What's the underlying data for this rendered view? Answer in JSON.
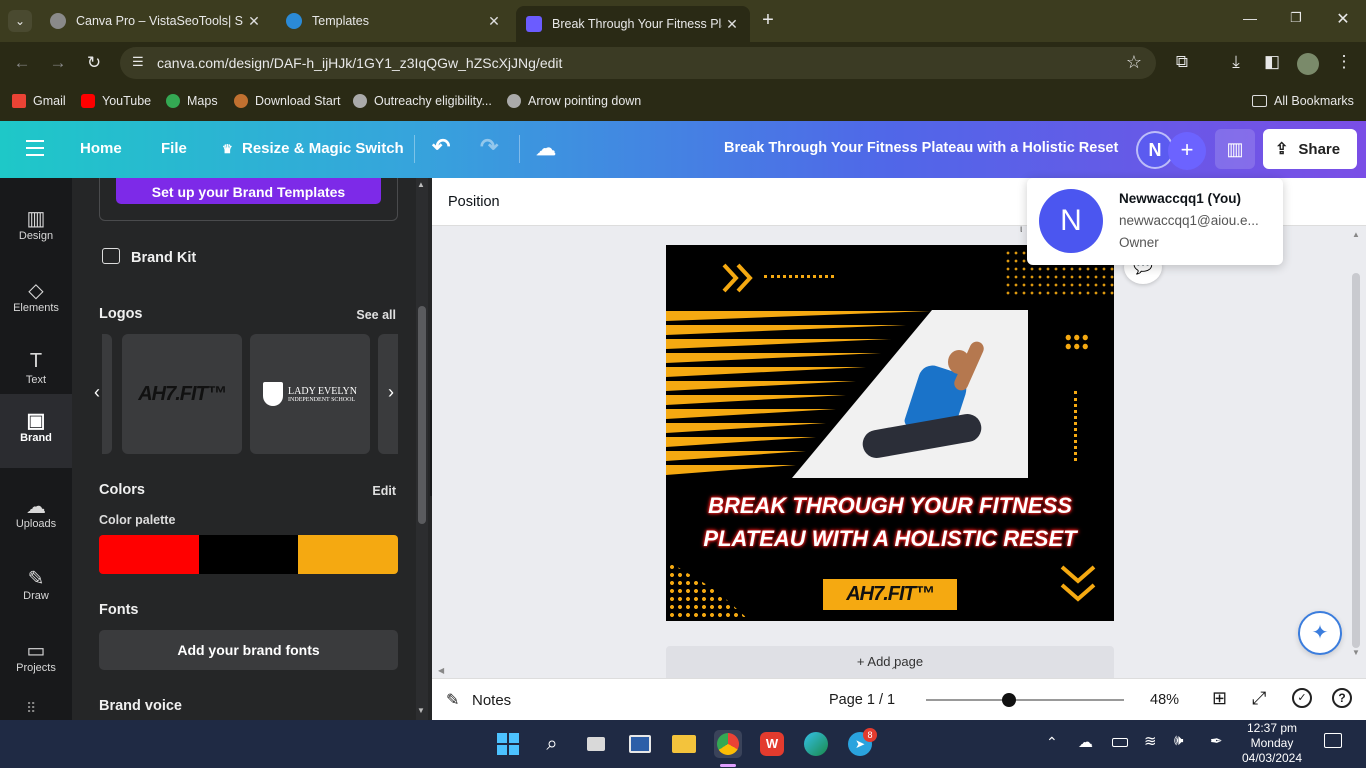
{
  "browser": {
    "tabs": [
      {
        "title": "Canva Pro – VistaSeoTools| SEO",
        "favicon_color": "#8a8a8a"
      },
      {
        "title": "Templates",
        "favicon_color": "#2b8ad6"
      },
      {
        "title": "Break Through Your Fitness Plat",
        "favicon_color": "#6b5cff"
      }
    ],
    "url": "canva.com/design/DAF-h_ijHJk/1GY1_z3IqQGw_hZScXjJNg/edit",
    "bookmarks": [
      {
        "label": "Gmail",
        "color": "#ea4335"
      },
      {
        "label": "YouTube",
        "color": "#ff0000"
      },
      {
        "label": "Maps",
        "color": "#34a853"
      },
      {
        "label": "Download Start",
        "color": "#c07030"
      },
      {
        "label": "Outreachy eligibility...",
        "color": "#aaaaaa"
      },
      {
        "label": "Arrow pointing down",
        "color": "#aaaaaa"
      }
    ],
    "all_bookmarks": "All Bookmarks"
  },
  "header": {
    "home": "Home",
    "file": "File",
    "resize": "Resize & Magic Switch",
    "title": "Break Through Your Fitness Plateau with a Holistic Reset",
    "avatar_letter": "N",
    "share": "Share"
  },
  "rail": [
    {
      "label": "Design",
      "icon": "design-icon",
      "glyph": "▥"
    },
    {
      "label": "Elements",
      "icon": "elements-icon",
      "glyph": "◇"
    },
    {
      "label": "Text",
      "icon": "text-icon",
      "glyph": "T"
    },
    {
      "label": "Brand",
      "icon": "brand-icon",
      "glyph": "▣"
    },
    {
      "label": "Uploads",
      "icon": "uploads-icon",
      "glyph": "☁"
    },
    {
      "label": "Draw",
      "icon": "draw-icon",
      "glyph": "✎"
    },
    {
      "label": "Projects",
      "icon": "projects-icon",
      "glyph": "▭"
    }
  ],
  "panel": {
    "brand_templates_button": "Set up your Brand Templates",
    "brand_kit": "Brand Kit",
    "logos_title": "Logos",
    "logos_see_all": "See all",
    "logo1_text": "AH7.FIT™",
    "logo2_line1": "LADY EVELYN",
    "logo2_line2": "INDEPENDENT SCHOOL",
    "colors_title": "Colors",
    "colors_edit": "Edit",
    "palette_label": "Color palette",
    "palette": [
      "#ff0000",
      "#000000",
      "#f5a911"
    ],
    "fonts_title": "Fonts",
    "add_fonts": "Add your brand fonts",
    "brand_voice": "Brand voice"
  },
  "workspace": {
    "position": "Position",
    "headline_line1": "BREAK THROUGH YOUR FITNESS",
    "headline_line2": "PLATEAU WITH A HOLISTIC RESET",
    "logo_badge": "AH7.FIT™",
    "add_page": "+ Add page"
  },
  "popover": {
    "name": "Newwaccqq1 (You)",
    "email": "newwaccqq1@aiou.e...",
    "role": "Owner",
    "letter": "N"
  },
  "footer": {
    "notes": "Notes",
    "page": "Page 1 / 1",
    "zoom": "48%",
    "zoom_level_fraction": 0.4
  },
  "taskbar": {
    "time": "12:37 pm",
    "day": "Monday",
    "date": "04/03/2024",
    "telegram_badge": "8"
  },
  "colors": {
    "accent_purple": "#7d2ae8",
    "design_yellow": "#f5a911",
    "design_red": "#e01b1b"
  }
}
